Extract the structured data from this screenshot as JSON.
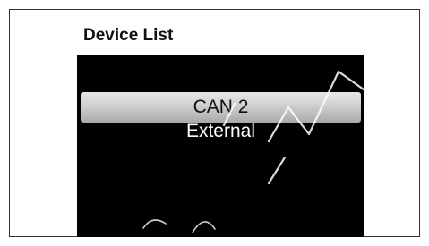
{
  "screen": {
    "title": "Device List",
    "items": [
      {
        "label": "CAN 2",
        "selected": true
      },
      {
        "label": "External",
        "selected": false
      }
    ]
  },
  "colors": {
    "screen_background": "#000000",
    "title_background": "#ffffff",
    "selection_highlight": "#c8c8c8",
    "item_text": "#ffffff"
  }
}
